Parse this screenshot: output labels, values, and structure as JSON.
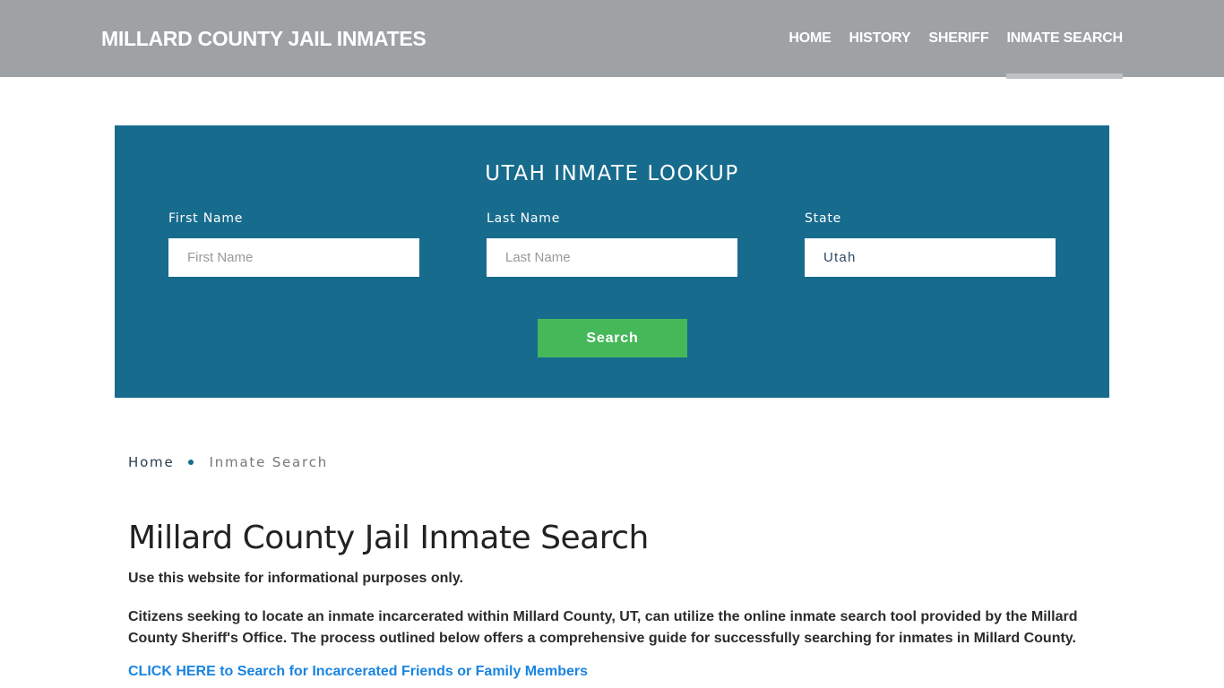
{
  "header": {
    "brand": "MILLARD COUNTY JAIL INMATES",
    "nav": [
      {
        "label": "HOME",
        "active": false
      },
      {
        "label": "HISTORY",
        "active": false
      },
      {
        "label": "SHERIFF",
        "active": false
      },
      {
        "label": "INMATE SEARCH",
        "active": true
      }
    ]
  },
  "lookup": {
    "title": "UTAH INMATE LOOKUP",
    "fields": {
      "first_name": {
        "label": "First Name",
        "placeholder": "First Name",
        "value": ""
      },
      "last_name": {
        "label": "Last Name",
        "placeholder": "Last Name",
        "value": ""
      },
      "state": {
        "label": "State",
        "value": "Utah"
      }
    },
    "search_label": "Search"
  },
  "breadcrumb": {
    "home": "Home",
    "current": "Inmate Search"
  },
  "content": {
    "title": "Millard County Jail Inmate Search",
    "disclaimer": "Use this website for informational purposes only.",
    "intro": "Citizens seeking to locate an inmate incarcerated within Millard County, UT, can utilize the online inmate search tool provided by the Millard County Sheriff's Office. The process outlined below offers a comprehensive guide for successfully searching for inmates in Millard County.",
    "cta": "CLICK HERE to Search for Incarcerated Friends or Family Members"
  },
  "colors": {
    "header_bg": "#9ea2a5",
    "lookup_bg": "#176b8d",
    "search_button": "#45b85a",
    "link": "#1a84e0"
  }
}
